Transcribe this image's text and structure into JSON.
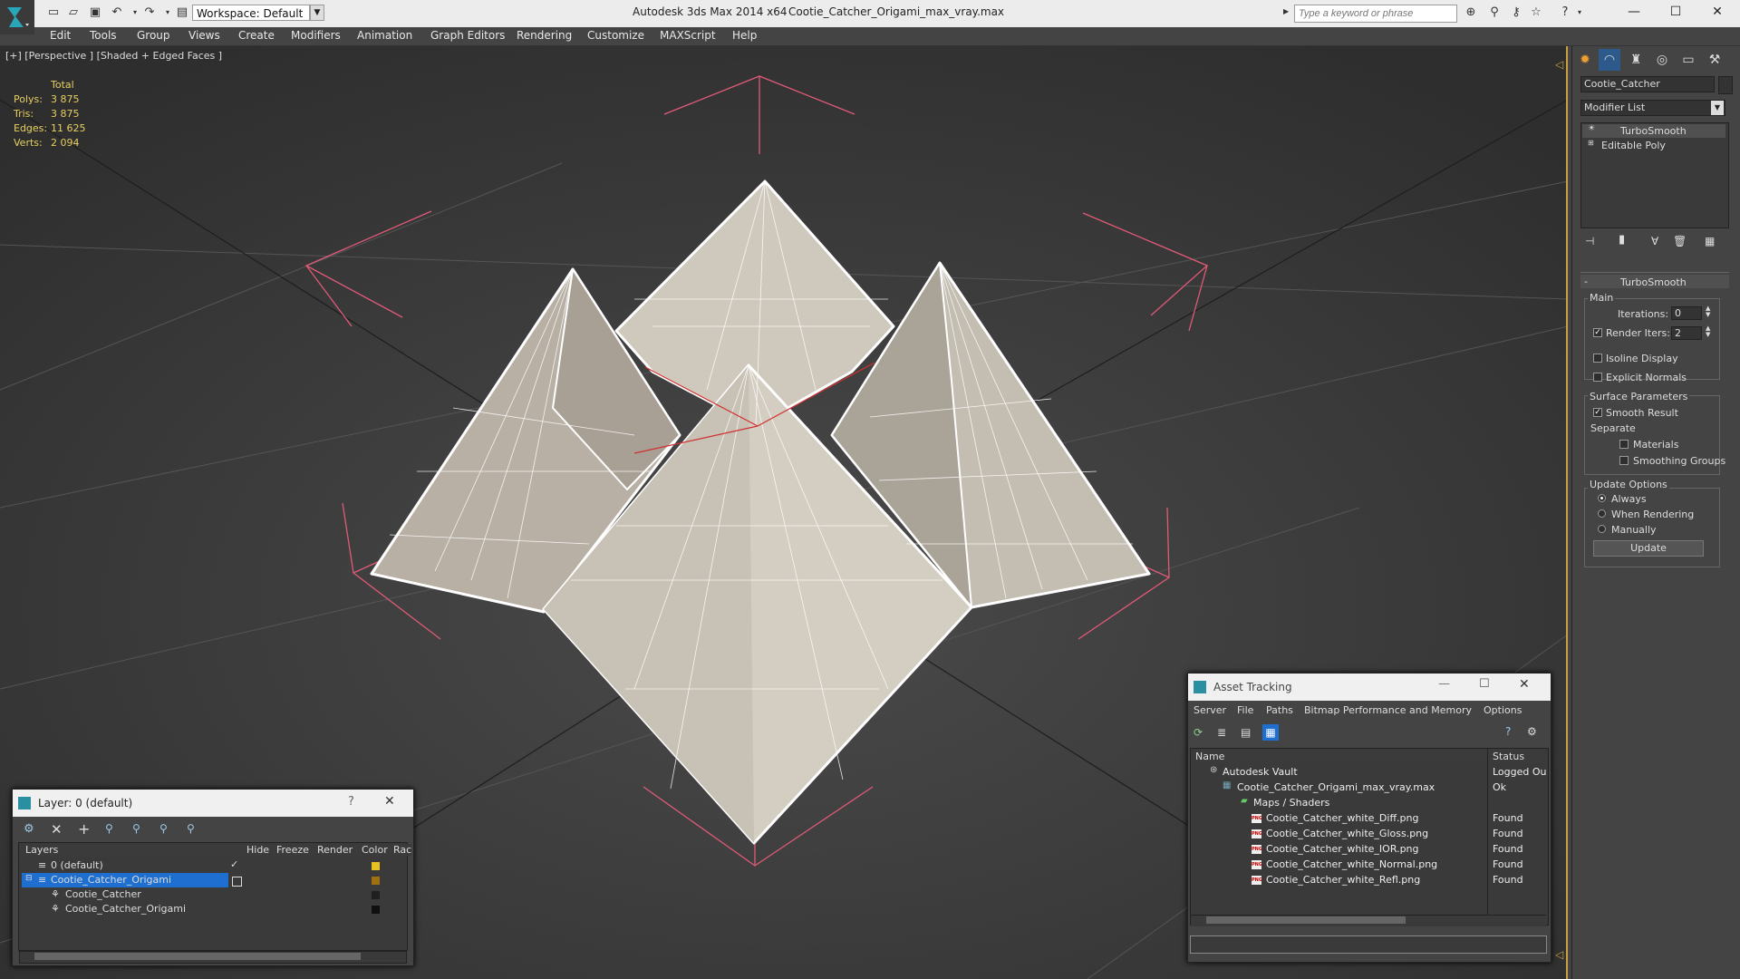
{
  "titlebar": {
    "workspace": "Workspace: Default",
    "app_title": "Autodesk 3ds Max  2014 x64",
    "doc_title": "Cootie_Catcher_Origami_max_vray.max",
    "search_placeholder": "Type a keyword or phrase"
  },
  "menu": [
    "Edit",
    "Tools",
    "Group",
    "Views",
    "Create",
    "Modifiers",
    "Animation",
    "Graph Editors",
    "Rendering",
    "Customize",
    "MAXScript",
    "Help"
  ],
  "viewport": {
    "label": "[+] [Perspective ] [Shaded + Edged Faces ]",
    "stats_header": "Total",
    "stats": [
      {
        "label": "Polys:",
        "value": "3 875"
      },
      {
        "label": "Tris:",
        "value": "3 875"
      },
      {
        "label": "Edges:",
        "value": "11 625"
      },
      {
        "label": "Verts:",
        "value": "2 094"
      }
    ]
  },
  "command_panel": {
    "object_name": "Cootie_Catcher",
    "modifier_list": "Modifier List",
    "stack": [
      "TurboSmooth",
      "Editable Poly"
    ],
    "rollout_title": "TurboSmooth",
    "main_group": "Main",
    "iterations_label": "Iterations:",
    "iterations_value": "0",
    "render_iters_label": "Render Iters:",
    "render_iters_value": "2",
    "isoline_display": "Isoline Display",
    "explicit_normals": "Explicit Normals",
    "surface_params": "Surface Parameters",
    "smooth_result": "Smooth Result",
    "separate": "Separate",
    "materials": "Materials",
    "smoothing_groups": "Smoothing Groups",
    "update_options": "Update Options",
    "always": "Always",
    "when_rendering": "When Rendering",
    "manually": "Manually",
    "update_button": "Update"
  },
  "layer_window": {
    "title": "Layer: 0 (default)",
    "help": "?",
    "columns": [
      "Layers",
      "Hide",
      "Freeze",
      "Render",
      "Color",
      "Rac"
    ],
    "rows": [
      {
        "name": "0 (default)",
        "color": "#e8c020"
      },
      {
        "name": "Cootie_Catcher_Origami",
        "color": "#a07010"
      },
      {
        "name": "Cootie_Catcher",
        "color": "#202020"
      },
      {
        "name": "Cootie_Catcher_Origami",
        "color": "#101010"
      }
    ]
  },
  "asset_window": {
    "title": "Asset Tracking",
    "menu": [
      "Server",
      "File",
      "Paths",
      "Bitmap Performance and Memory",
      "Options"
    ],
    "columns": [
      "Name",
      "Status"
    ],
    "rows": [
      {
        "name": "Autodesk Vault",
        "status": "Logged Ou"
      },
      {
        "name": "Cootie_Catcher_Origami_max_vray.max",
        "status": "Ok"
      },
      {
        "name": "Maps / Shaders",
        "status": ""
      },
      {
        "name": "Cootie_Catcher_white_Diff.png",
        "status": "Found"
      },
      {
        "name": "Cootie_Catcher_white_Gloss.png",
        "status": "Found"
      },
      {
        "name": "Cootie_Catcher_white_IOR.png",
        "status": "Found"
      },
      {
        "name": "Cootie_Catcher_white_Normal.png",
        "status": "Found"
      },
      {
        "name": "Cootie_Catcher_white_Refl.png",
        "status": "Found"
      }
    ]
  },
  "colors": {
    "accent": "#c8a040",
    "selection": "#1e6fd0",
    "stats_text": "#e8d060",
    "bbox_lines": "#e05a78"
  }
}
